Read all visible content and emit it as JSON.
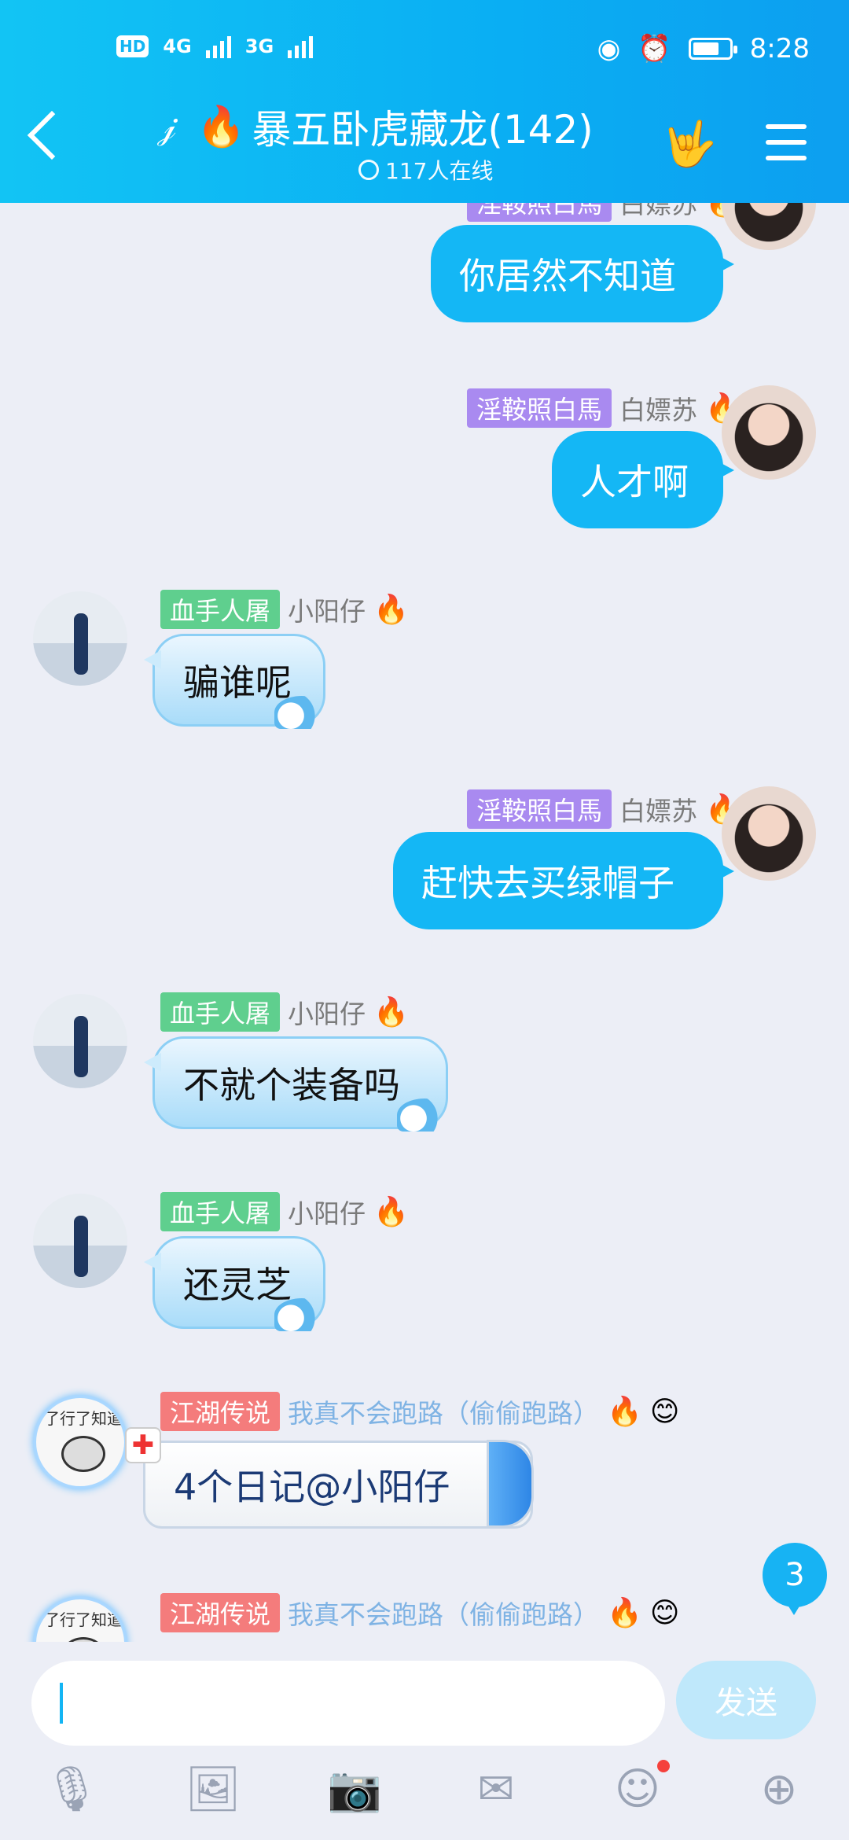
{
  "status": {
    "hd": "HD",
    "sig1": "4G",
    "sig2": "3G",
    "time": "8:28"
  },
  "header": {
    "title": "暴五卧虎藏龙(142)",
    "online": "117人在线"
  },
  "messages": [
    {
      "side": "right",
      "tag": "淫鞍照白馬",
      "nick": "白嫖苏",
      "text": "你居然不知道"
    },
    {
      "side": "right",
      "tag": "淫鞍照白馬",
      "nick": "白嫖苏",
      "text": "人才啊"
    },
    {
      "side": "left",
      "tag": "血手人屠",
      "nick": "小阳仔",
      "text": "骗谁呢"
    },
    {
      "side": "right",
      "tag": "淫鞍照白馬",
      "nick": "白嫖苏",
      "text": "赶快去买绿帽子"
    },
    {
      "side": "left",
      "tag": "血手人屠",
      "nick": "小阳仔",
      "text": "不就个装备吗"
    },
    {
      "side": "left",
      "tag": "血手人屠",
      "nick": "小阳仔",
      "text": "还灵芝"
    },
    {
      "side": "left",
      "tag": "江湖传说",
      "nick": "我真不会跑路（偷偷跑路）",
      "text": "4个日记@小阳仔",
      "meme": "了行了知道"
    },
    {
      "side": "left",
      "tag": "江湖传说",
      "nick": "我真不会跑路（偷偷跑路）",
      "text": "",
      "meme": "了行了知道"
    }
  ],
  "unread_count": "3",
  "input": {
    "value": "",
    "send_label": "发送"
  },
  "toolbar": [
    "mic-icon",
    "image-icon",
    "camera-icon",
    "red-packet-icon",
    "emoji-icon",
    "plus-icon"
  ]
}
